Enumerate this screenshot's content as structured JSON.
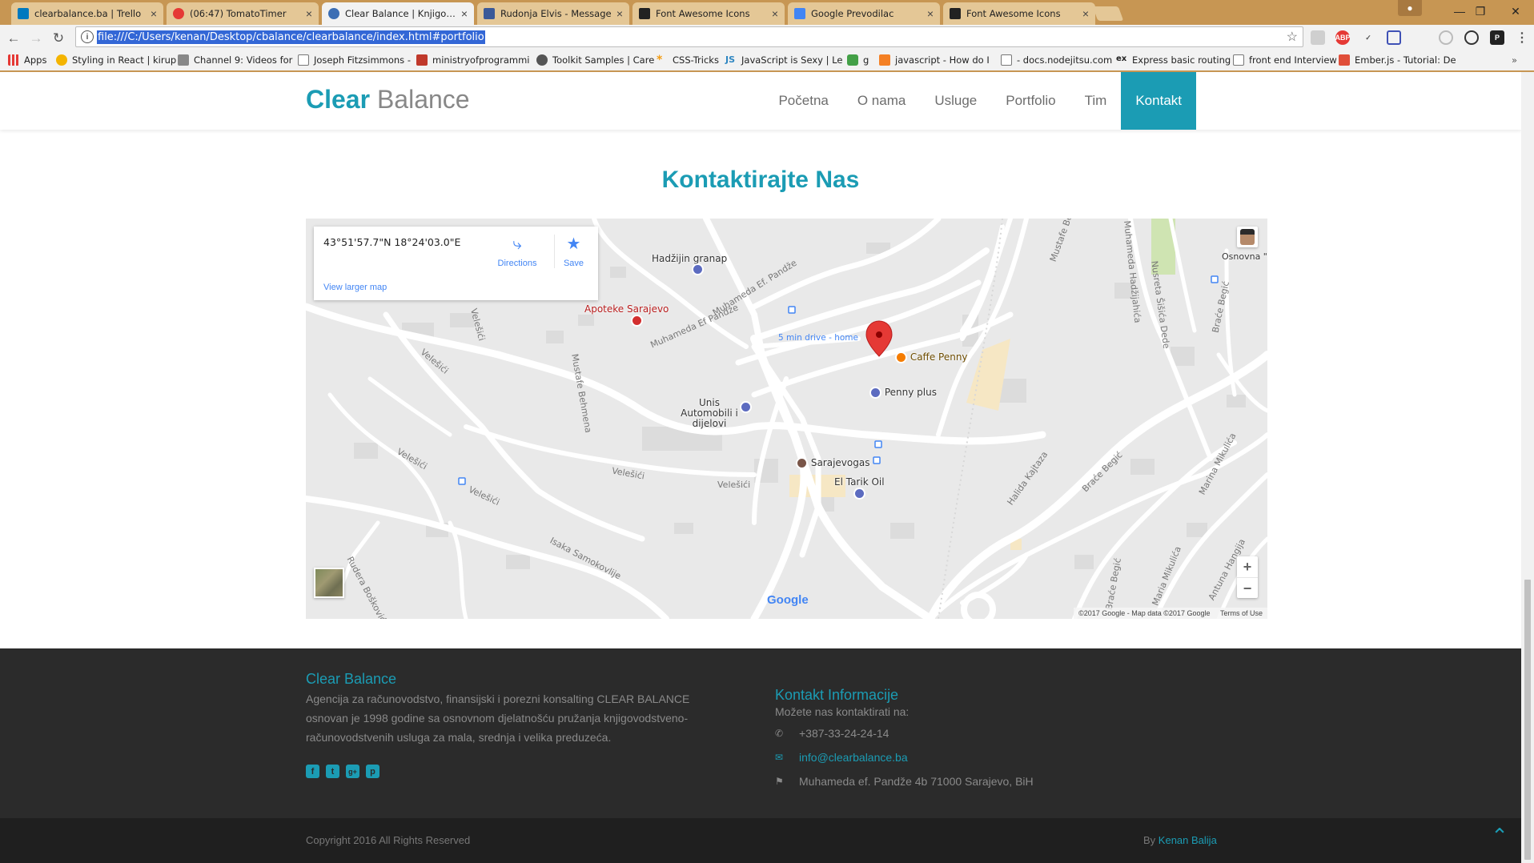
{
  "browser": {
    "tabs": [
      {
        "label": "clearbalance.ba | Trello",
        "favicon_color": "#0079bf"
      },
      {
        "label": "(06:47) TomatoTimer",
        "favicon_color": "#e53935"
      },
      {
        "label": "Clear Balance | Knjigovo",
        "favicon_color": "#3c6eb4"
      },
      {
        "label": "Rudonja Elvis - Message",
        "favicon_color": "#3b5998"
      },
      {
        "label": "Font Awesome Icons",
        "favicon_color": "#222222"
      },
      {
        "label": "Google Prevodilac",
        "favicon_color": "#4285f4"
      },
      {
        "label": "Font Awesome Icons",
        "favicon_color": "#222222"
      }
    ],
    "url": "file:///C:/Users/kenan/Desktop/cbalance/clearbalance/index.html#portfolio",
    "extensions": [
      {
        "icon": "ext-grid-icon",
        "color": "#9e9e9e",
        "text": ""
      },
      {
        "icon": "adblock-plus-icon",
        "color": "#e53935",
        "text": "ABP"
      },
      {
        "icon": "eyedropper-icon",
        "color": "#555555",
        "text": ""
      },
      {
        "icon": "screenshot-icon",
        "color": "#3f51b5",
        "text": ""
      },
      {
        "icon": "ext-circle-icon",
        "color": "#9e9e9e",
        "text": ""
      },
      {
        "icon": "ext-sync-icon",
        "color": "#333333",
        "text": ""
      },
      {
        "icon": "producthunt-icon",
        "color": "#222222",
        "text": "P"
      }
    ],
    "bookmarks": [
      {
        "label": "Apps",
        "icon_color": "#e53935"
      },
      {
        "label": "Styling in React | kirup",
        "icon_color": "#f4b400"
      },
      {
        "label": "Channel 9: Videos for",
        "icon_color": "#888888"
      },
      {
        "label": "Joseph Fitzsimmons -",
        "icon_color": "#bbbbbb"
      },
      {
        "label": "ministryofprogrammi",
        "icon_color": "#c0392b"
      },
      {
        "label": "Toolkit Samples | Care",
        "icon_color": "#555555"
      },
      {
        "label": "CSS-Tricks",
        "icon_color": "#f39c12"
      },
      {
        "label": "JavaScript is Sexy | Le",
        "icon_color": "#2e86c1"
      },
      {
        "label": "g",
        "icon_color": "#43a047"
      },
      {
        "label": "javascript - How do I",
        "icon_color": "#f48024"
      },
      {
        "label": "- docs.nodejitsu.com",
        "icon_color": "#bbbbbb"
      },
      {
        "label": "Express basic routing",
        "icon_color": "#333333"
      },
      {
        "label": "front end Interview",
        "icon_color": "#bbbbbb"
      },
      {
        "label": "Ember.js - Tutorial: De",
        "icon_color": "#e04e39"
      }
    ]
  },
  "site": {
    "brand_primary": "Clear",
    "brand_secondary": "Balance",
    "accent_color": "#1b9cb4",
    "nav": [
      "Početna",
      "O nama",
      "Usluge",
      "Portfolio",
      "Tim",
      "Kontakt"
    ],
    "active_nav": "Kontakt",
    "contact_title": "Kontaktirajte Nas"
  },
  "map": {
    "coords": "43°51'57.7\"N 18°24'03.0\"E",
    "directions": "Directions",
    "save": "Save",
    "view_larger": "View larger map",
    "pin_label": "5 min drive - home",
    "pois": [
      "Hadžijin granap",
      "Apoteke Sarajevo",
      "Caffe Penny",
      "Penny plus",
      "Unis Automobili i dijelovi",
      "Sarajevogas",
      "El Tarik Oil",
      "Osnovna \"Mehme"
    ],
    "streets": [
      "Mustafe Behmena",
      "Muhameda Ef. Pandže",
      "Muhameda Ef Pandže",
      "Velešići",
      "Velešići",
      "Velešići",
      "Velešići",
      "Velešići",
      "Velešići",
      "Isaka Samokovlije",
      "Rudera Boškovića",
      "Halida Kajtaza",
      "Braće Begić",
      "Nusreta Šišića Dede",
      "Muhameda Hadžijahića",
      "Braće Begić",
      "Marina Mikulića",
      "Antuna Hangija",
      "Maria Mikulića",
      "Braće Begić",
      "Mustafe Behmena"
    ],
    "google": "Google",
    "attribution": "©2017 Google - Map data ©2017 Google",
    "terms": "Terms of Use",
    "zoom_in": "+",
    "zoom_out": "−"
  },
  "footer": {
    "about_title": "Clear Balance",
    "about_text": "Agencija za računovodstvo, finansijski i porezni konsalting CLEAR BALANCE osnovan je 1998 godine sa osnovnom djelatnošću pružanja knjigovodstveno-računovodstvenih usluga za mala, srednja i velika preduzeća.",
    "social": [
      {
        "icon": "facebook-icon",
        "glyph": "f"
      },
      {
        "icon": "twitter-icon",
        "glyph": "t"
      },
      {
        "icon": "google-plus-icon",
        "glyph": "g+"
      },
      {
        "icon": "pinterest-icon",
        "glyph": "p"
      }
    ],
    "contact_title": "Kontakt Informacije",
    "contact_sub": "Možete nas kontaktirati na:",
    "phone": "+387-33-24-24-14",
    "email": "info@clearbalance.ba",
    "address": "Muhameda ef. Pandže 4b 71000 Sarajevo, BiH",
    "copyright": "Copyright 2016 All Rights Reserved",
    "by_prefix": "By",
    "by_name": "Kenan Balija"
  }
}
